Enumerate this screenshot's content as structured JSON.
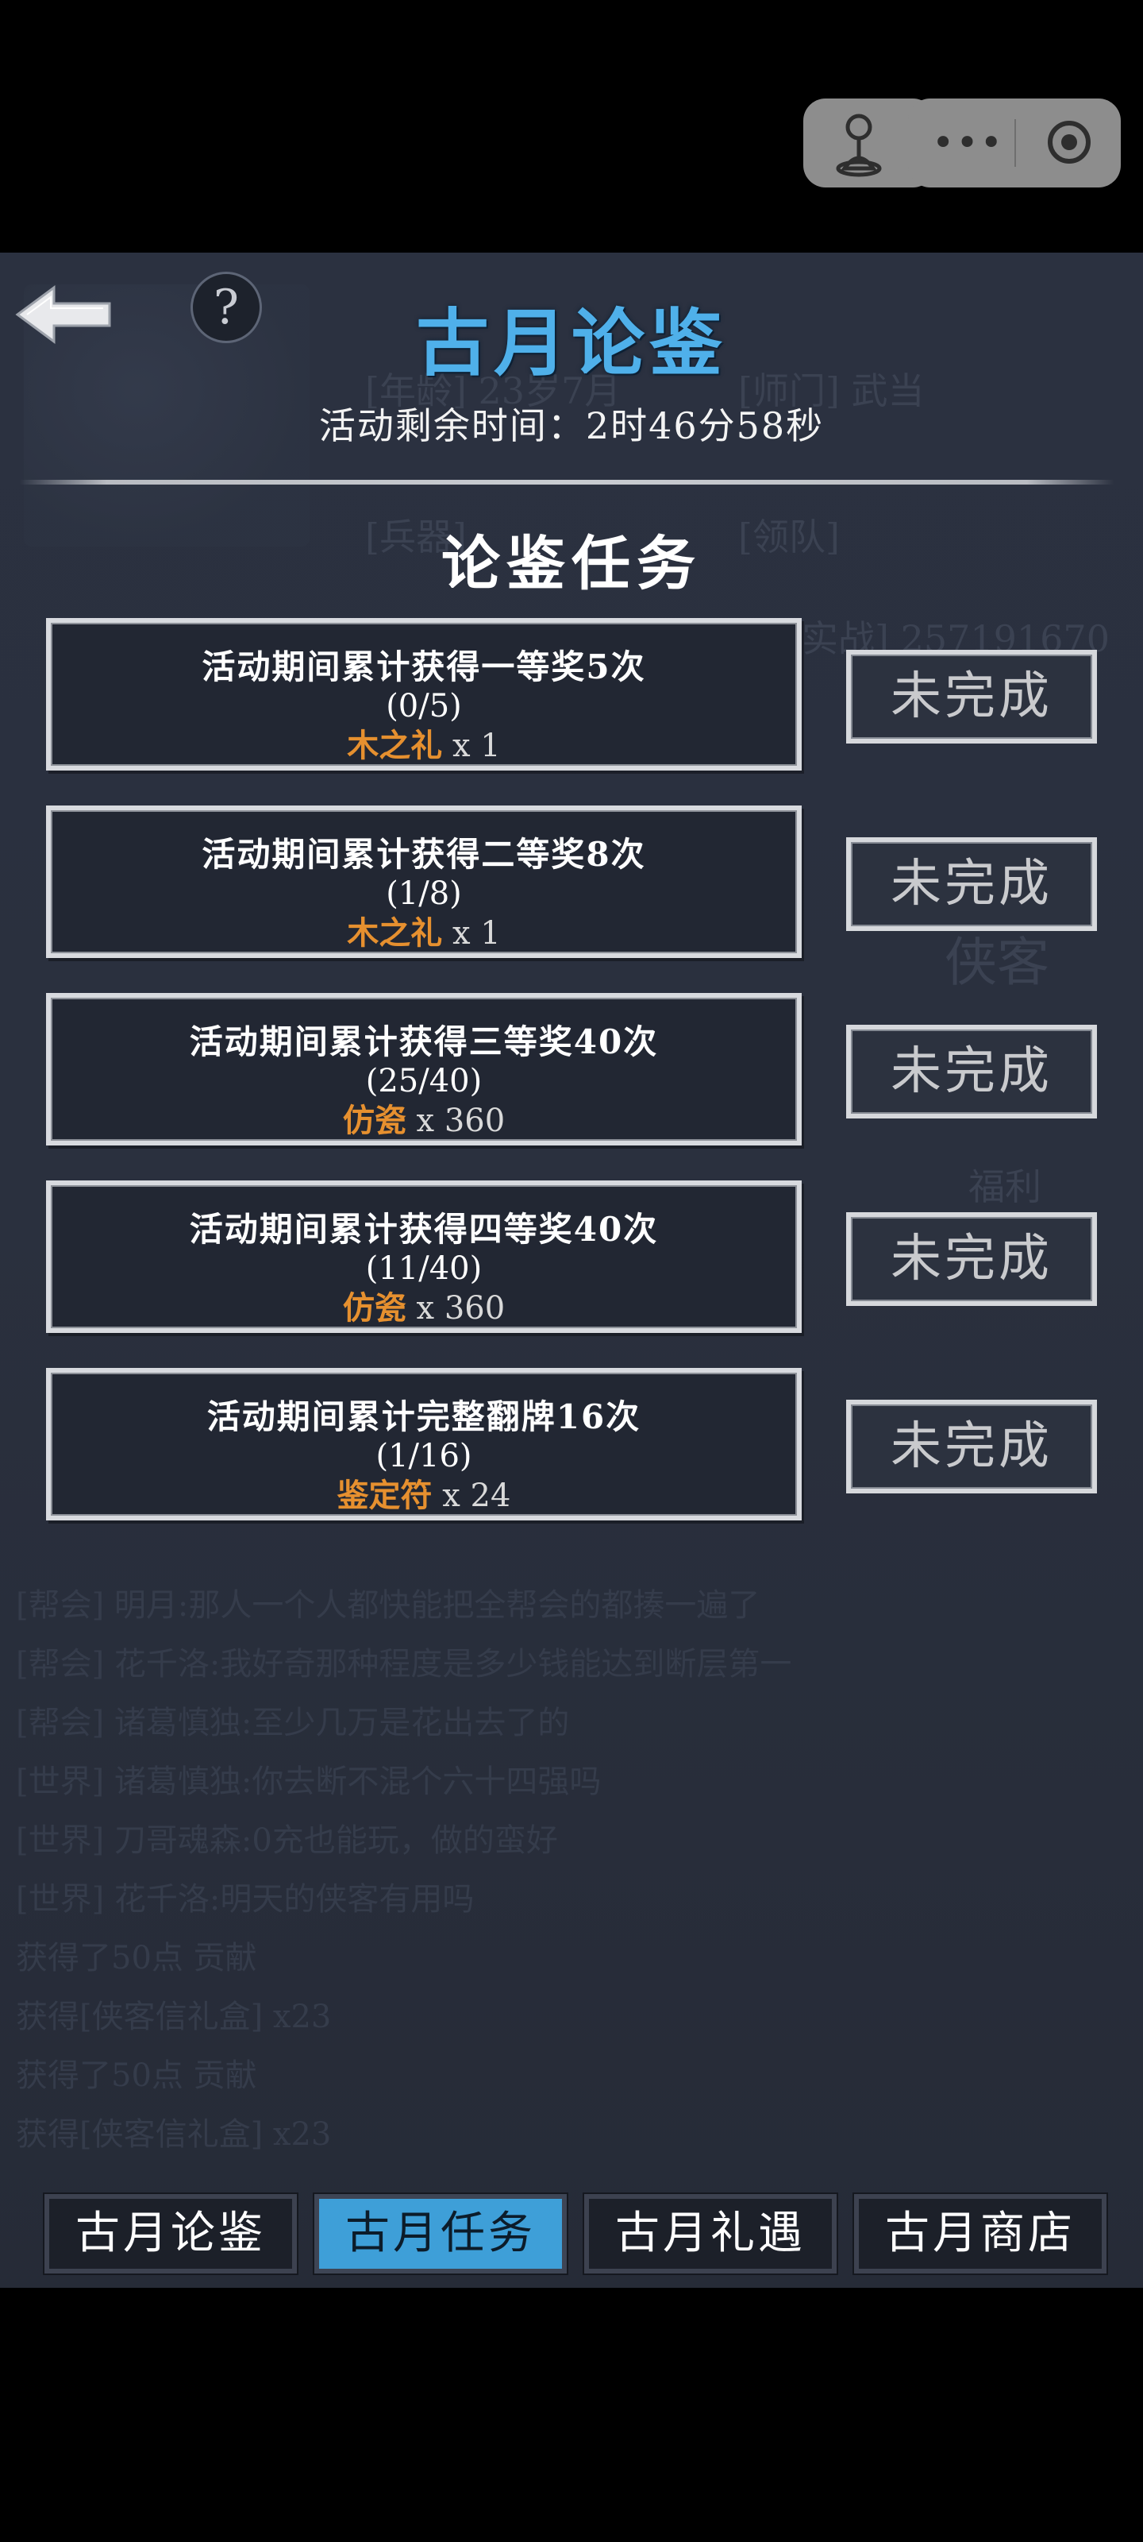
{
  "page": {
    "title": "古月论鉴",
    "timer_text": "活动剩余时间：2时46分58秒",
    "section_title": "论鉴任务"
  },
  "tasks": [
    {
      "description": "活动期间累计获得一等奖5次",
      "progress": "(0/5)",
      "reward_item": "木之礼",
      "reward_qty": "x 1",
      "status": "未完成"
    },
    {
      "description": "活动期间累计获得二等奖8次",
      "progress": "(1/8)",
      "reward_item": "木之礼",
      "reward_qty": "x 1",
      "status": "未完成"
    },
    {
      "description": "活动期间累计获得三等奖40次",
      "progress": "(25/40)",
      "reward_item": "仿瓷",
      "reward_qty": "x 360",
      "status": "未完成"
    },
    {
      "description": "活动期间累计获得四等奖40次",
      "progress": "(11/40)",
      "reward_item": "仿瓷",
      "reward_qty": "x 360",
      "status": "未完成"
    },
    {
      "description": "活动期间累计完整翻牌16次",
      "progress": "(1/16)",
      "reward_item": "鉴定符",
      "reward_qty": "x 24",
      "status": "未完成"
    }
  ],
  "tabs": [
    {
      "label": "古月论鉴",
      "active": false
    },
    {
      "label": "古月任务",
      "active": true
    },
    {
      "label": "古月礼遇",
      "active": false
    },
    {
      "label": "古月商店",
      "active": false
    }
  ],
  "background_text": {
    "top": [
      "[年龄] 23岁7月",
      "[师门] 武当",
      "[兵器]",
      "[领队]",
      "实战] 257191670",
      "侠客",
      "福利"
    ],
    "chat": [
      "[帮会] 明月:那人一个人都快能把全帮会的都揍一遍了",
      "[帮会] 花千洛:我好奇那种程度是多少钱能达到断层第一",
      "[帮会] 诸葛慎独:至少几万是花出去了的",
      "[世界] 诸葛慎独:你去断不混个六十四强吗",
      "[世界] 刀哥魂森:0充也能玩，做的蛮好",
      "[世界] 花千洛:明天的侠客有用吗",
      "获得了50点 贡献",
      "获得[侠客信礼盒] x23",
      "获得了50点 贡献",
      "获得[侠客信礼盒] x23"
    ]
  },
  "icons": {
    "back": "back-arrow-icon",
    "help": "help-icon",
    "accessibility": "person-outline-icon",
    "more": "more-dots-icon",
    "close": "target-close-icon"
  },
  "colors": {
    "title": "#4fb0ea",
    "reward_item": "#e6902f",
    "active_tab": "#3e9fd8",
    "background": "#2b3140"
  }
}
